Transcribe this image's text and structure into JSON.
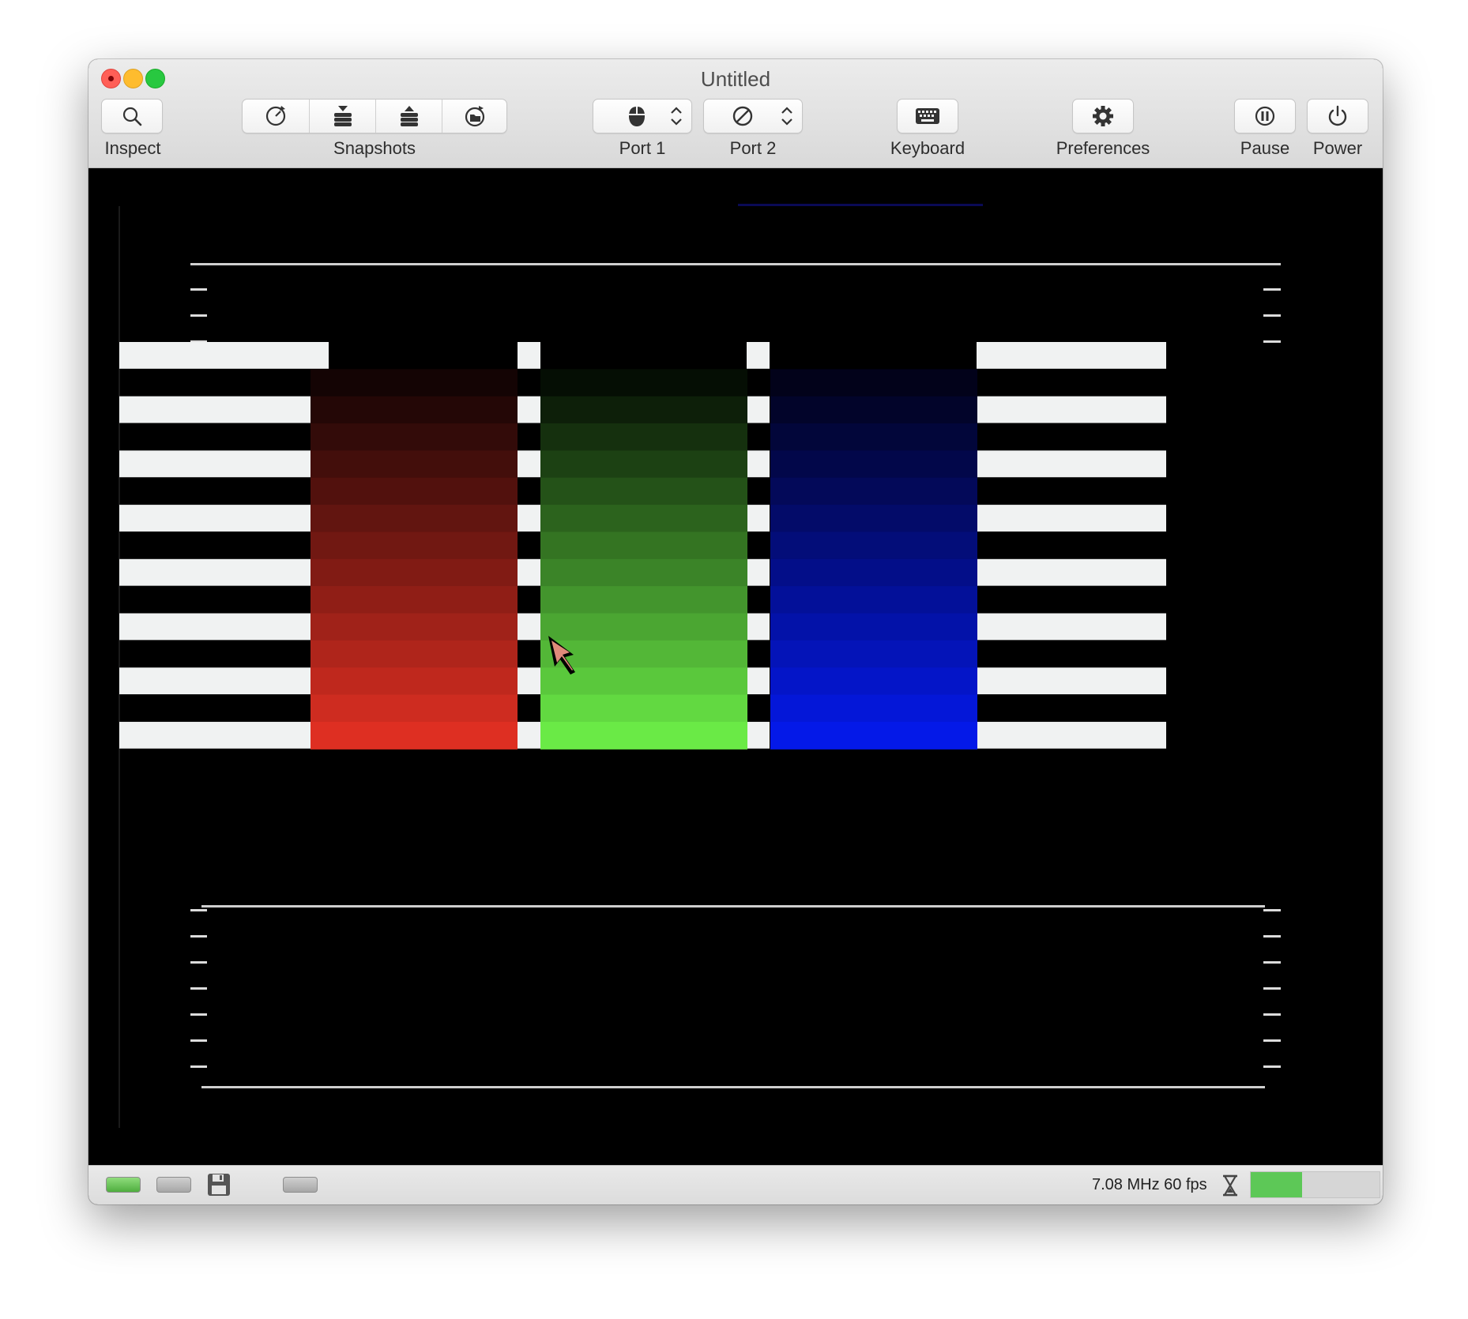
{
  "window": {
    "title": "Untitled"
  },
  "toolbar": {
    "inspect_label": "Inspect",
    "snapshots_label": "Snapshots",
    "port1_label": "Port 1",
    "port2_label": "Port 2",
    "keyboard_label": "Keyboard",
    "preferences_label": "Preferences",
    "pause_label": "Pause",
    "power_label": "Power"
  },
  "icons": {
    "inspect": "magnifier-icon",
    "snapshots": [
      "auto-snapshot-icon",
      "take-snapshot-icon",
      "restore-snapshot-icon",
      "browse-snapshots-icon"
    ],
    "port1": "mouse-icon",
    "port2": "no-device-icon",
    "keyboard": "keyboard-icon",
    "preferences": "gear-icon",
    "pause": "pause-icon",
    "power": "power-icon"
  },
  "screen": {
    "colors": {
      "red_top": "#140404",
      "red_bottom": "#de2f22",
      "green_top": "#050e04",
      "green_bottom": "#6aea46",
      "blue_top": "#02021a",
      "blue_bottom": "#0419e8",
      "stripe": "#f0f2f2"
    },
    "steps": 15
  },
  "status": {
    "speed_text": "7.08 MHz 60 fps",
    "speed_level": 0.4,
    "colors": {
      "led_on": "#8fdc7c",
      "speed_fill": "#5dc857"
    }
  }
}
